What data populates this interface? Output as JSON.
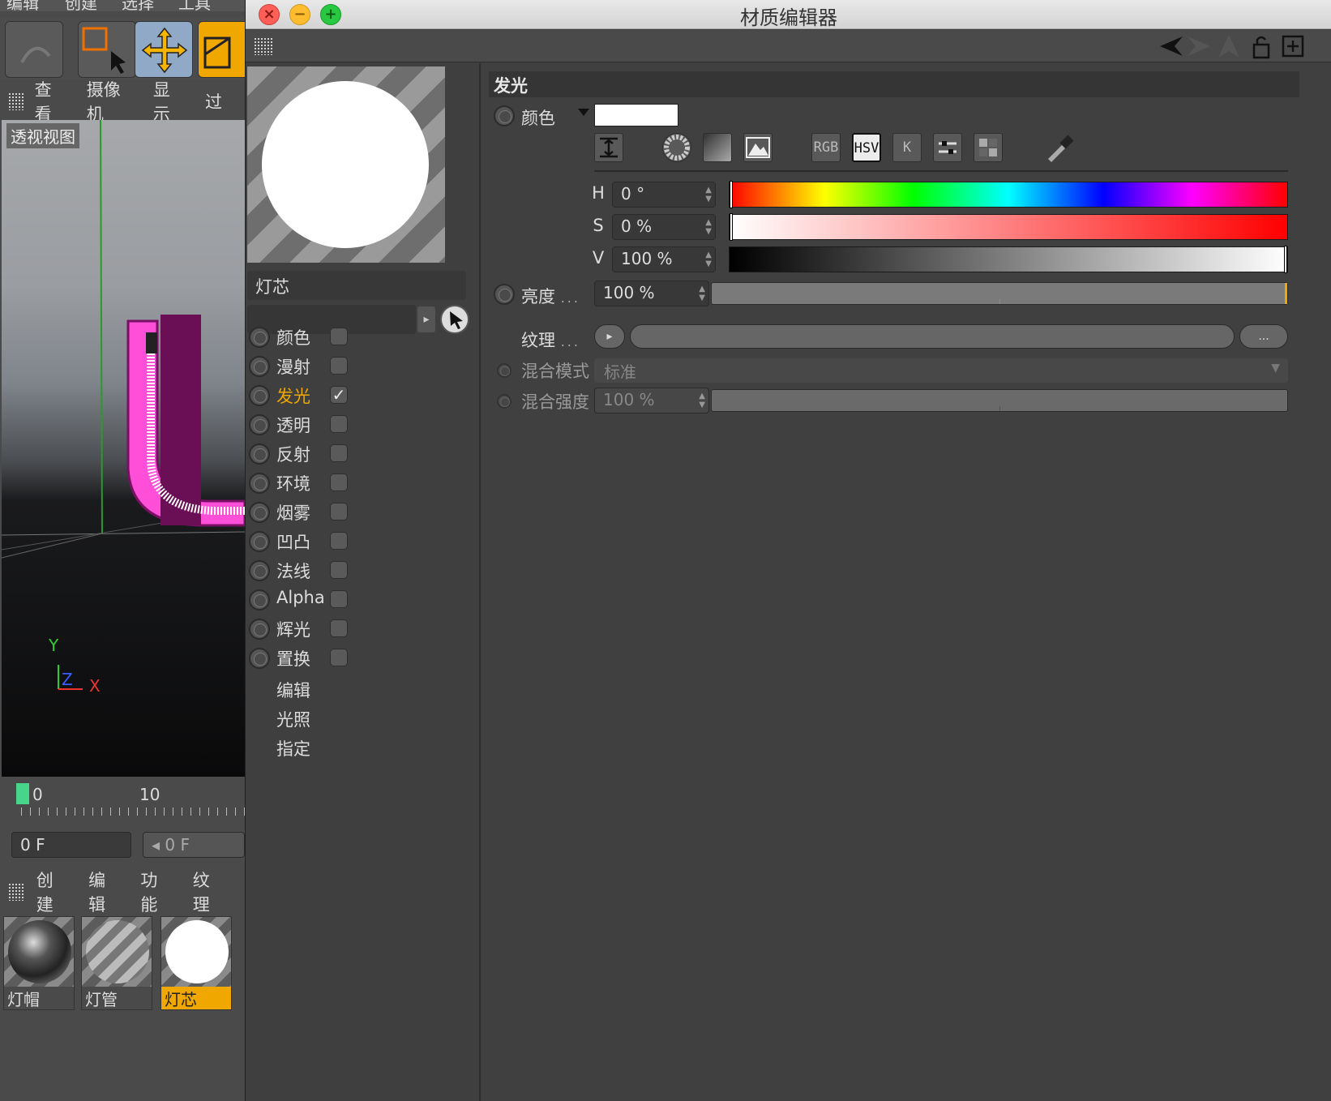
{
  "background_app": {
    "menu_top": [
      "编辑",
      "创建",
      "选择",
      "工具"
    ],
    "viewport_menu": [
      "查看",
      "摄像机",
      "显示",
      "过"
    ],
    "viewport_label": "透视视图",
    "axis": {
      "y": "Y",
      "z": "Z",
      "x": "X"
    },
    "timeline": {
      "start": "0",
      "mark": "10"
    },
    "frame_field": "0 F",
    "frame_field2": "0 F",
    "material_menu": [
      "创建",
      "编辑",
      "功能",
      "纹理"
    ],
    "materials": [
      {
        "name": "灯帽",
        "selected": false
      },
      {
        "name": "灯管",
        "selected": false
      },
      {
        "name": "灯芯",
        "selected": true
      }
    ]
  },
  "editor": {
    "title": "材质编辑器",
    "material_name": "灯芯",
    "channels": [
      {
        "label": "颜色",
        "checked": false,
        "active": false
      },
      {
        "label": "漫射",
        "checked": false,
        "active": false
      },
      {
        "label": "发光",
        "checked": true,
        "active": true
      },
      {
        "label": "透明",
        "checked": false,
        "active": false
      },
      {
        "label": "反射",
        "checked": false,
        "active": false
      },
      {
        "label": "环境",
        "checked": false,
        "active": false
      },
      {
        "label": "烟雾",
        "checked": false,
        "active": false
      },
      {
        "label": "凹凸",
        "checked": false,
        "active": false
      },
      {
        "label": "法线",
        "checked": false,
        "active": false
      },
      {
        "label": "Alpha",
        "checked": false,
        "active": false
      },
      {
        "label": "辉光",
        "checked": false,
        "active": false
      },
      {
        "label": "置换",
        "checked": false,
        "active": false
      }
    ],
    "sub_items": [
      "编辑",
      "光照",
      "指定"
    ],
    "panel": {
      "section": "发光",
      "color_label": "颜色",
      "color_value": "#ffffff",
      "picker_modes": [
        "RGB",
        "HSV",
        "K"
      ],
      "picker_active": "HSV",
      "h": {
        "label": "H",
        "value": "0 °",
        "fraction": 0.0
      },
      "s": {
        "label": "S",
        "value": "0 %",
        "fraction": 0.0
      },
      "v": {
        "label": "V",
        "value": "100 %",
        "fraction": 1.0
      },
      "brightness": {
        "label": "亮度",
        "dots": "...",
        "value": "100 %"
      },
      "texture": {
        "label": "纹理",
        "dots": "...",
        "more": "..."
      },
      "blend_mode": {
        "label": "混合模式",
        "value": "标准"
      },
      "blend_strength": {
        "label": "混合强度",
        "value": "100 %"
      }
    }
  },
  "colors": {
    "accent": "#f0a800",
    "selection_green": "#46d58b",
    "pink_object": "#ff4fd8"
  }
}
